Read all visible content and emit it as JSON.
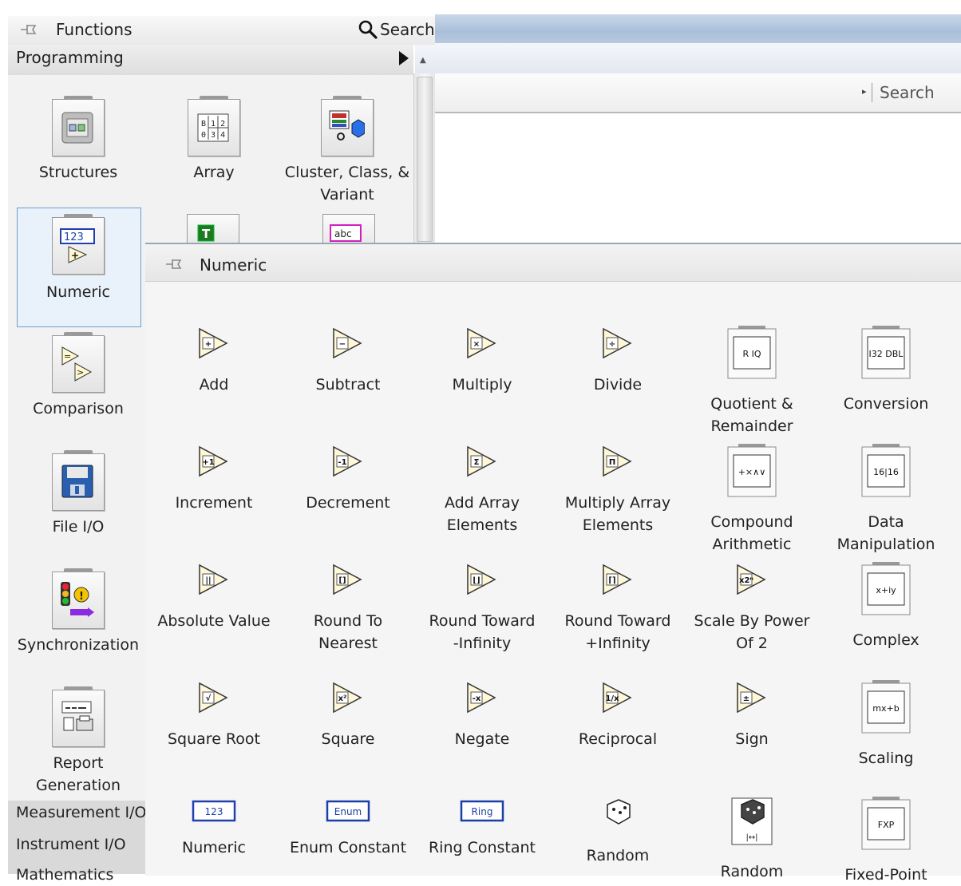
{
  "functions_palette": {
    "title": "Functions",
    "search_label": "Search",
    "category": "Programming",
    "subcategories": [
      {
        "label": "Structures",
        "icon": "structures-icon"
      },
      {
        "label": "Array",
        "icon": "array-icon"
      },
      {
        "label": "Cluster, Class, &\nVariant",
        "icon": "cluster-icon"
      },
      {
        "label": "Numeric",
        "icon": "numeric-icon",
        "selected": true
      },
      {
        "label": "Comparison",
        "icon": "comparison-icon"
      },
      {
        "label": "File I/O",
        "icon": "file-io-icon"
      },
      {
        "label": "Synchronization",
        "icon": "synchronization-icon"
      },
      {
        "label": "Report\nGeneration",
        "icon": "report-generation-icon"
      }
    ],
    "side_list": [
      "Measurement I/O",
      "Instrument I/O",
      "Mathematics"
    ]
  },
  "background_window": {
    "search_label": "Search"
  },
  "numeric_palette": {
    "title": "Numeric",
    "rows": [
      [
        {
          "label": "Add",
          "icon": "add-icon",
          "glyph": "+"
        },
        {
          "label": "Subtract",
          "icon": "subtract-icon",
          "glyph": "−"
        },
        {
          "label": "Multiply",
          "icon": "multiply-icon",
          "glyph": "×"
        },
        {
          "label": "Divide",
          "icon": "divide-icon",
          "glyph": "÷"
        },
        {
          "label": "Quotient &\nRemainder",
          "icon": "quotient-remainder-icon",
          "glyph": "R IQ"
        },
        {
          "label": "Conversion",
          "icon": "conversion-icon",
          "glyph": "I32 DBL"
        }
      ],
      [
        {
          "label": "Increment",
          "icon": "increment-icon",
          "glyph": "+1"
        },
        {
          "label": "Decrement",
          "icon": "decrement-icon",
          "glyph": "-1"
        },
        {
          "label": "Add Array\nElements",
          "icon": "add-array-elements-icon",
          "glyph": "Σ"
        },
        {
          "label": "Multiply Array\nElements",
          "icon": "multiply-array-elements-icon",
          "glyph": "Π"
        },
        {
          "label": "Compound\nArithmetic",
          "icon": "compound-arithmetic-icon",
          "glyph": "+×∧∨"
        },
        {
          "label": "Data\nManipulation",
          "icon": "data-manipulation-icon",
          "glyph": "16|16"
        }
      ],
      [
        {
          "label": "Absolute Value",
          "icon": "absolute-value-icon",
          "glyph": "||"
        },
        {
          "label": "Round To\nNearest",
          "icon": "round-to-nearest-icon",
          "glyph": "[]"
        },
        {
          "label": "Round Toward\n-Infinity",
          "icon": "round-toward-neg-infinity-icon",
          "glyph": "⌊⌋"
        },
        {
          "label": "Round Toward\n+Infinity",
          "icon": "round-toward-pos-infinity-icon",
          "glyph": "⌈⌉"
        },
        {
          "label": "Scale By Power\nOf 2",
          "icon": "scale-by-power-of-2-icon",
          "glyph": "x2ⁿ"
        },
        {
          "label": "Complex",
          "icon": "complex-icon",
          "glyph": "x+iy"
        }
      ],
      [
        {
          "label": "Square Root",
          "icon": "square-root-icon",
          "glyph": "√"
        },
        {
          "label": "Square",
          "icon": "square-icon",
          "glyph": "x²"
        },
        {
          "label": "Negate",
          "icon": "negate-icon",
          "glyph": "-x"
        },
        {
          "label": "Reciprocal",
          "icon": "reciprocal-icon",
          "glyph": "1/x"
        },
        {
          "label": "Sign",
          "icon": "sign-icon",
          "glyph": "±"
        },
        {
          "label": "Scaling",
          "icon": "scaling-icon",
          "glyph": "mx+b"
        }
      ],
      [
        {
          "label": "Numeric",
          "icon": "numeric-constant-icon",
          "glyph": "123"
        },
        {
          "label": "Enum Constant",
          "icon": "enum-constant-icon",
          "glyph": "Enum"
        },
        {
          "label": "Ring Constant",
          "icon": "ring-constant-icon",
          "glyph": "Ring"
        },
        {
          "label": "Random",
          "icon": "random-number-icon",
          "glyph": "dice"
        },
        {
          "label": "Random",
          "icon": "random-number-range-icon",
          "glyph": "dice-range"
        },
        {
          "label": "Fixed-Point",
          "icon": "fixed-point-icon",
          "glyph": "FXP"
        }
      ]
    ]
  }
}
